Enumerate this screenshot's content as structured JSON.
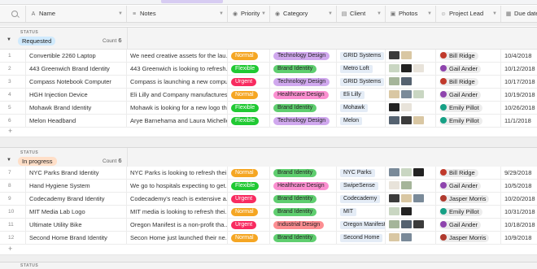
{
  "columns": {
    "name": "Name",
    "notes": "Notes",
    "priority": "Priority",
    "category": "Category",
    "client": "Client",
    "photos": "Photos",
    "project_lead": "Project Lead",
    "due_date": "Due date"
  },
  "colors": {
    "Normal": "#f5a623",
    "Flexible": "#20c933",
    "Urgent": "#f82b60",
    "Technology Design": "#d0a8ee",
    "Brand Identity": "#5fce6f",
    "Healthcare Design": "#fb8fd0",
    "Industrial Design": "#fd8e92",
    "requested_chip": "#d0eafd",
    "in_progress_chip": "#ffdfc8"
  },
  "groups": [
    {
      "status_label": "STATUS",
      "status": "Requested",
      "count_label": "Count",
      "count": "6",
      "rows": [
        {
          "num": "1",
          "name": "Convertible 2260 Laptop",
          "notes": "We need creative assets for the lau...",
          "priority": "Normal",
          "category": "Technology Design",
          "client": "GRID Systems",
          "lead": "Bill Ridge",
          "due": "10/4/2018"
        },
        {
          "num": "2",
          "name": "443 Greenwich Brand Identity",
          "notes": "443 Greenwich is looking to refresh...",
          "priority": "Flexible",
          "category": "Brand Identity",
          "client": "Metro Loft",
          "lead": "Gail Ander",
          "due": "10/12/2018"
        },
        {
          "num": "3",
          "name": "Compass Notebook Computer",
          "notes": "Compass is launching a new compu...",
          "priority": "Urgent",
          "category": "Technology Design",
          "client": "GRID Systems",
          "lead": "Bill Ridge",
          "due": "10/17/2018"
        },
        {
          "num": "4",
          "name": "HGH Injection Device",
          "notes": "Eli Lilly and Company manufactures...",
          "priority": "Normal",
          "category": "Healthcare Design",
          "client": "Eli Lilly",
          "lead": "Gail Ander",
          "due": "10/19/2018"
        },
        {
          "num": "5",
          "name": "Mohawk Brand Identity",
          "notes": "Mohawk is looking for a new logo th...",
          "priority": "Flexible",
          "category": "Brand Identity",
          "client": "Mohawk",
          "lead": "Emily Pillot",
          "due": "10/26/2018"
        },
        {
          "num": "6",
          "name": "Melon Headband",
          "notes": "Arye Barnehama and Laura Michelle...",
          "priority": "Flexible",
          "category": "Technology Design",
          "client": "Melon",
          "lead": "Emily Pillot",
          "due": "11/1/2018"
        }
      ]
    },
    {
      "status_label": "STATUS",
      "status": "In progress",
      "count_label": "Count",
      "count": "6",
      "rows": [
        {
          "num": "7",
          "name": "NYC Parks Brand Identity",
          "notes": "NYC Parks is looking to refresh thei...",
          "priority": "Normal",
          "category": "Brand Identity",
          "client": "NYC Parks",
          "lead": "Bill Ridge",
          "due": "9/29/2018"
        },
        {
          "num": "8",
          "name": "Hand Hygiene System",
          "notes": "We go to hospitals expecting to get...",
          "priority": "Flexible",
          "category": "Healthcare Design",
          "client": "SwipeSense",
          "lead": "Gail Ander",
          "due": "10/5/2018"
        },
        {
          "num": "9",
          "name": "Codecademy Brand Identity",
          "notes": "Codecademy's reach is extensive a...",
          "priority": "Urgent",
          "category": "Brand Identity",
          "client": "Codecademy",
          "lead": "Jasper Morris",
          "due": "10/20/2018"
        },
        {
          "num": "10",
          "name": "MIT Media Lab Logo",
          "notes": "MIT media is looking to refresh thei...",
          "priority": "Normal",
          "category": "Brand Identity",
          "client": "MIT",
          "lead": "Emily Pillot",
          "due": "10/31/2018"
        },
        {
          "num": "11",
          "name": "Ultimate Utility Bike",
          "notes": "Oregon Manifest is a non-profit tha...",
          "priority": "Urgent",
          "category": "Industrial Design",
          "client": "Oregon Manifest",
          "lead": "Gail Ander",
          "due": "10/18/2018"
        },
        {
          "num": "12",
          "name": "Second Home Brand Identity",
          "notes": "Secon Home just launched their ne...",
          "priority": "Normal",
          "category": "Brand Identity",
          "client": "Second Home",
          "lead": "Jasper Morris",
          "due": "10/9/2018"
        }
      ]
    }
  ],
  "footer_status_label": "STATUS"
}
